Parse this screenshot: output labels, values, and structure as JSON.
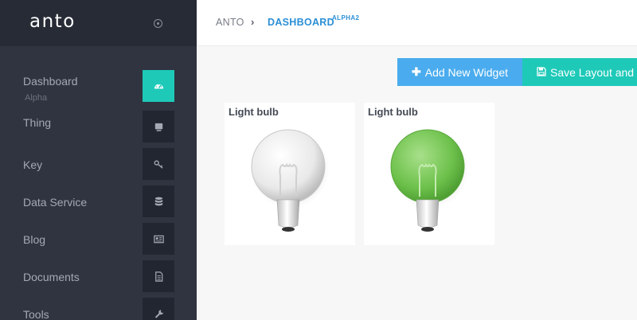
{
  "app": {
    "logo": "anto"
  },
  "breadcrumb": {
    "root": "ANTO",
    "separator": "›",
    "current": "DASHBOARD",
    "badge": "ALPHA2"
  },
  "sidebar": {
    "items": [
      {
        "label": "Dashboard",
        "sub": "Alpha",
        "icon": "dashboard-gauge-icon",
        "active": true
      },
      {
        "label": "Thing",
        "icon": "device-icon"
      },
      {
        "label": "Key",
        "icon": "key-icon"
      },
      {
        "label": "Data Service",
        "icon": "database-icon"
      },
      {
        "label": "Blog",
        "icon": "newspaper-icon"
      },
      {
        "label": "Documents",
        "icon": "document-icon"
      },
      {
        "label": "Tools",
        "icon": "wrench-icon"
      }
    ]
  },
  "toolbar": {
    "add_label": "Add New Widget",
    "add_icon": "plus-icon",
    "save_label": "Save Layout and",
    "save_icon": "floppy-disk-icon"
  },
  "widgets": [
    {
      "title": "Light bulb",
      "state": "off"
    },
    {
      "title": "Light bulb",
      "state": "on"
    }
  ],
  "colors": {
    "sidebar": "#2f3440",
    "accent_teal": "#1ec9b8",
    "accent_blue": "#4aacee",
    "breadcrumb_active": "#2b8fd6",
    "bulb_on": "#6cc04a"
  }
}
